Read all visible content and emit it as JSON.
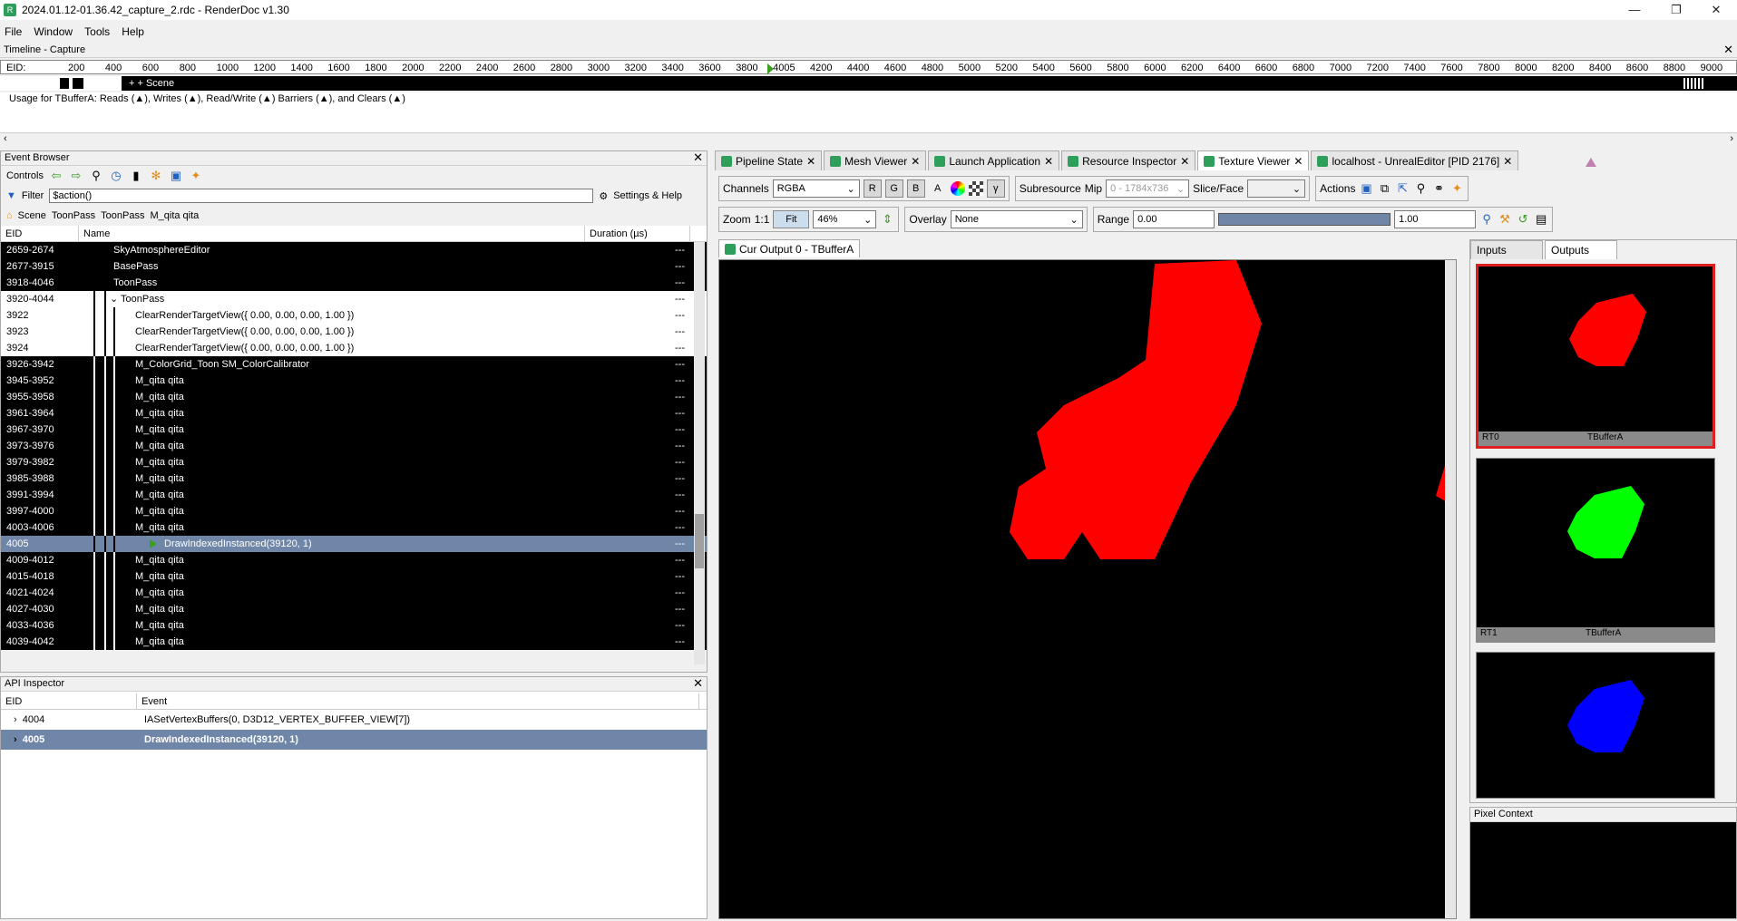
{
  "window": {
    "title": "2024.01.12-01.36.42_capture_2.rdc - RenderDoc v1.30",
    "min": "—",
    "max": "❐",
    "close": "✕"
  },
  "menu": [
    "File",
    "Window",
    "Tools",
    "Help"
  ],
  "timeline": {
    "title": "Timeline - Capture",
    "eid_label": "EID:",
    "ticks": [
      "200",
      "400",
      "600",
      "800",
      "1000",
      "1200",
      "1400",
      "1600",
      "1800",
      "2000",
      "2200",
      "2400",
      "2600",
      "2800",
      "3000",
      "3200",
      "3400",
      "3600",
      "3800",
      "4005",
      "4200",
      "4400",
      "4600",
      "4800",
      "5000",
      "5200",
      "5400",
      "5600",
      "5800",
      "6000",
      "6200",
      "6400",
      "6600",
      "6800",
      "7000",
      "7200",
      "7400",
      "7600",
      "7800",
      "8000",
      "8200",
      "8400",
      "8600",
      "8800",
      "9000"
    ],
    "scene_label": "+ + Scene",
    "usage_text": "Usage for TBufferA: Reads (▲), Writes (▲), Read/Write (▲) Barriers (▲), and Clears (▲)"
  },
  "event_browser": {
    "title": "Event Browser",
    "controls_label": "Controls",
    "filter_label": "Filter",
    "filter_value": "$action()",
    "settings_label": "Settings & Help",
    "breadcrumbs": [
      "Scene",
      "ToonPass",
      "ToonPass",
      "M_qita qita"
    ],
    "columns": [
      "EID",
      "Name",
      "Duration (µs)"
    ],
    "rows": [
      {
        "eid": "2659-2674",
        "name": "SkyAtmosphereEditor",
        "dur": "---",
        "style": "black",
        "indent": 1
      },
      {
        "eid": "2677-3915",
        "name": "BasePass",
        "dur": "---",
        "style": "black",
        "indent": 1
      },
      {
        "eid": "3918-4046",
        "name": "ToonPass",
        "dur": "---",
        "style": "black",
        "indent": 1
      },
      {
        "eid": "3920-4044",
        "name": "ToonPass",
        "dur": "---",
        "style": "white",
        "indent": 2,
        "expander": "⌄"
      },
      {
        "eid": "3922",
        "name": "ClearRenderTargetView({ 0.00, 0.00, 0.00, 1.00 })",
        "dur": "---",
        "style": "white",
        "indent": 3
      },
      {
        "eid": "3923",
        "name": "ClearRenderTargetView({ 0.00, 0.00, 0.00, 1.00 })",
        "dur": "---",
        "style": "white",
        "indent": 3
      },
      {
        "eid": "3924",
        "name": "ClearRenderTargetView({ 0.00, 0.00, 0.00, 1.00 })",
        "dur": "---",
        "style": "white",
        "indent": 3
      },
      {
        "eid": "3926-3942",
        "name": "M_ColorGrid_Toon SM_ColorCalibrator",
        "dur": "---",
        "style": "black",
        "indent": 3
      },
      {
        "eid": "3945-3952",
        "name": "M_qita qita",
        "dur": "---",
        "style": "black",
        "indent": 3
      },
      {
        "eid": "3955-3958",
        "name": "M_qita qita",
        "dur": "---",
        "style": "black",
        "indent": 3
      },
      {
        "eid": "3961-3964",
        "name": "M_qita qita",
        "dur": "---",
        "style": "black",
        "indent": 3
      },
      {
        "eid": "3967-3970",
        "name": "M_qita qita",
        "dur": "---",
        "style": "black",
        "indent": 3
      },
      {
        "eid": "3973-3976",
        "name": "M_qita qita",
        "dur": "---",
        "style": "black",
        "indent": 3
      },
      {
        "eid": "3979-3982",
        "name": "M_qita qita",
        "dur": "---",
        "style": "black",
        "indent": 3
      },
      {
        "eid": "3985-3988",
        "name": "M_qita qita",
        "dur": "---",
        "style": "black",
        "indent": 3
      },
      {
        "eid": "3991-3994",
        "name": "M_qita qita",
        "dur": "---",
        "style": "black",
        "indent": 3
      },
      {
        "eid": "3997-4000",
        "name": "M_qita qita",
        "dur": "---",
        "style": "black",
        "indent": 3
      },
      {
        "eid": "4003-4006",
        "name": "M_qita qita",
        "dur": "---",
        "style": "black",
        "indent": 3
      },
      {
        "eid": "4005",
        "name": "DrawIndexedInstanced(39120, 1)",
        "dur": "---",
        "style": "sel",
        "indent": 4
      },
      {
        "eid": "4009-4012",
        "name": "M_qita qita",
        "dur": "---",
        "style": "black",
        "indent": 3
      },
      {
        "eid": "4015-4018",
        "name": "M_qita qita",
        "dur": "---",
        "style": "black",
        "indent": 3
      },
      {
        "eid": "4021-4024",
        "name": "M_qita qita",
        "dur": "---",
        "style": "black",
        "indent": 3
      },
      {
        "eid": "4027-4030",
        "name": "M_qita qita",
        "dur": "---",
        "style": "black",
        "indent": 3
      },
      {
        "eid": "4033-4036",
        "name": "M_qita qita",
        "dur": "---",
        "style": "black",
        "indent": 3
      },
      {
        "eid": "4039-4042",
        "name": "M_qita qita",
        "dur": "---",
        "style": "black",
        "indent": 3
      }
    ]
  },
  "api_inspector": {
    "title": "API Inspector",
    "columns": [
      "EID",
      "Event"
    ],
    "rows": [
      {
        "eid": "4004",
        "event": "IASetVertexBuffers(0, D3D12_VERTEX_BUFFER_VIEW[7])",
        "selected": false
      },
      {
        "eid": "4005",
        "event": "DrawIndexedInstanced(39120, 1)",
        "selected": true
      }
    ]
  },
  "tabs": [
    "Pipeline State",
    "Mesh Viewer",
    "Launch Application",
    "Resource Inspector",
    "Texture Viewer",
    "localhost - UnrealEditor [PID 2176]"
  ],
  "active_tab": "Texture Viewer",
  "texture_viewer": {
    "channels_label": "Channels",
    "channels_value": "RGBA",
    "channel_buttons": [
      "R",
      "G",
      "B",
      "A"
    ],
    "gamma": "γ",
    "subresource_label": "Subresource",
    "mip_label": "Mip",
    "mip_value": "0 - 1784x736",
    "slice_label": "Slice/Face",
    "actions_label": "Actions",
    "zoom_label": "Zoom",
    "zoom_1to1": "1:1",
    "fit_label": "Fit",
    "zoom_value": "46%",
    "overlay_label": "Overlay",
    "overlay_value": "None",
    "range_label": "Range",
    "range_min": "0.00",
    "range_max": "1.00",
    "output_tab": "Cur Output 0 - TBufferA",
    "inputs_tab": "Inputs",
    "outputs_tab": "Outputs",
    "thumbnails": [
      {
        "slot": "RT0",
        "name": "TBufferA",
        "color": "#ff0000"
      },
      {
        "slot": "RT1",
        "name": "TBufferA",
        "color": "#00ff00"
      },
      {
        "slot": "",
        "name": "",
        "color": "#0000ff"
      }
    ],
    "pixel_context_label": "Pixel Context"
  }
}
